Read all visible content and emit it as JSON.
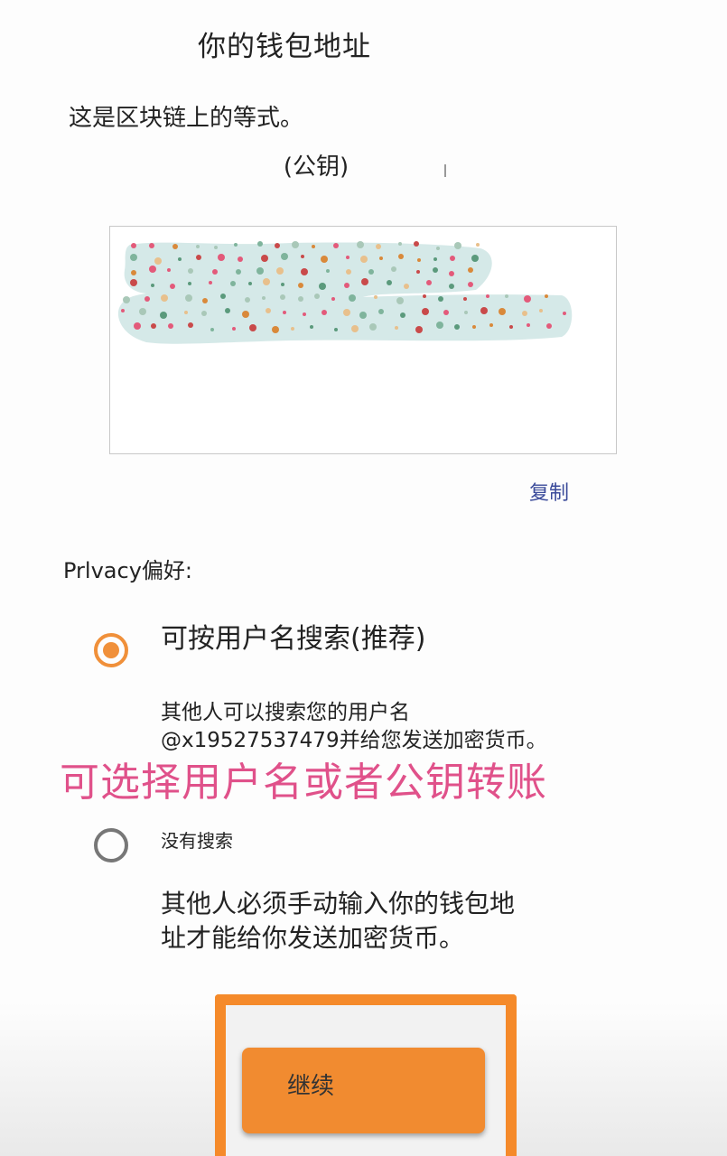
{
  "header": {
    "title": "你的钱包地址"
  },
  "wallet": {
    "description": "这是区块链上的等式。",
    "pubkey_label": "(公钥)",
    "copy_label": "复制"
  },
  "privacy": {
    "heading": "Prlvacy偏好:",
    "options": [
      {
        "label": "可按用户名搜索(推荐)",
        "desc_line1": "其他人可以搜索您的用户名",
        "desc_line2": "@x19527537479并给您发送加密货币。",
        "selected": true
      },
      {
        "label": "没有搜索",
        "desc_line1": "其他人必须手动输入你的钱包地",
        "desc_line2": "址才能给你发送加密货币。",
        "selected": false
      }
    ]
  },
  "overlay": {
    "caption": "可选择用户名或者公钥转账"
  },
  "footer": {
    "continue_label": "继续"
  },
  "colors": {
    "accent": "#f0903a",
    "link": "#3a4a9a",
    "caption": "#e0518a",
    "highlight_frame": "#f58a2a"
  }
}
